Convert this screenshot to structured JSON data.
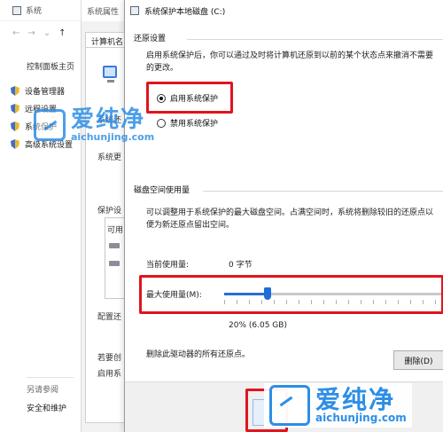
{
  "system_window": {
    "title": "系统",
    "home_link": "控制面板主页",
    "nav_items": [
      {
        "label": "设备管理器"
      },
      {
        "label": "远程设置"
      },
      {
        "label": "系统保护"
      },
      {
        "label": "高级系统设置"
      }
    ],
    "see_also": "另请参阅",
    "security_link": "安全和维护"
  },
  "properties_window": {
    "title": "系统属性",
    "tab_label": "计算机名",
    "text_fragments": [
      "系统还",
      "系统更",
      "保护设",
      "可用",
      "配置还",
      "若要创",
      "启用系"
    ]
  },
  "dialog": {
    "title": "系统保护本地磁盘 (C:)",
    "restore_section": {
      "label": "还原设置",
      "description": "启用系统保护后，你可以通过及时将计算机还原到以前的某个状态点来撤消不需要的更改。",
      "options": [
        {
          "label": "启用系统保护",
          "selected": true
        },
        {
          "label": "禁用系统保护",
          "selected": false
        }
      ]
    },
    "disk_section": {
      "label": "磁盘空间使用量",
      "description": "可以调整用于系统保护的最大磁盘空间。占满空间时，系统将删除较旧的还原点以便为新还原点留出空间。",
      "current_usage_label": "当前使用量:",
      "current_usage_value": "0 字节",
      "max_usage_label": "最大使用量(M):",
      "slider_percent": 20,
      "max_usage_value": "20% (6.05 GB)"
    },
    "delete_text": "删除此驱动器的所有还原点。",
    "delete_button": "删除(D)"
  },
  "watermark": {
    "brand_cn": "爱纯净",
    "url": "aichunjing.com"
  },
  "colors": {
    "highlight": "#e0141e",
    "accent": "#1f6dd6",
    "watermark": "#2d8ee6"
  }
}
